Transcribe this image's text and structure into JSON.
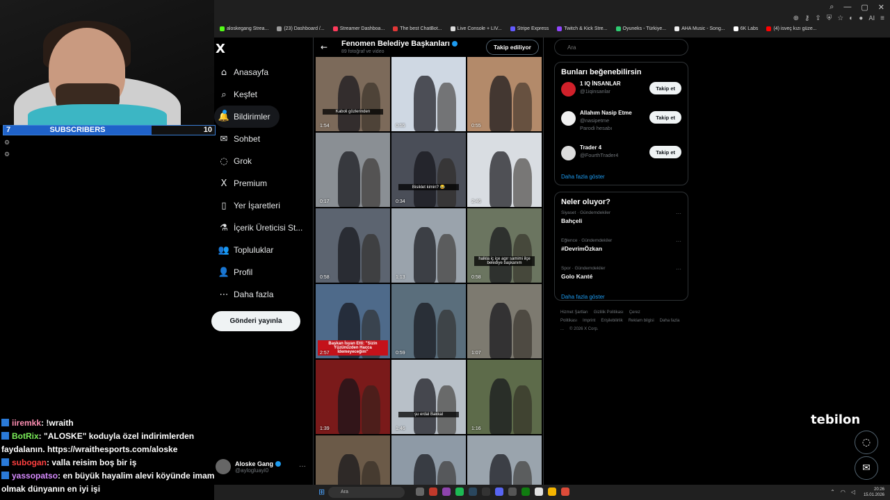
{
  "browser": {
    "bookmarks": [
      {
        "label": "aloskegang Strea...",
        "color": "#53fc18"
      },
      {
        "label": "(23) Dashboard /...",
        "color": "#9b9b9b"
      },
      {
        "label": "Streamer Dashboa...",
        "color": "#ff3b5c"
      },
      {
        "label": "The best ChatBot...",
        "color": "#e23737"
      },
      {
        "label": "Live Console + LIV...",
        "color": "#dddddd"
      },
      {
        "label": "Stripe Express",
        "color": "#635bff"
      },
      {
        "label": "Twitch & Kick Stre...",
        "color": "#9146ff"
      },
      {
        "label": "Oyuneks - Türkiye...",
        "color": "#2ecc71"
      },
      {
        "label": "AHA Music - Song...",
        "color": "#eeeeee"
      },
      {
        "label": "6K Labs",
        "color": "#ffffff"
      },
      {
        "label": "(4) isveç kızı güze...",
        "color": "#ff0000"
      }
    ],
    "ai_label": "AI"
  },
  "stream": {
    "sub_count": "7",
    "sub_label": "SUBSCRIBERS",
    "sub_goal": "10",
    "sub_progress": 0.7,
    "brand": "tebilon",
    "chat": [
      {
        "user": "iiremkk",
        "text": ": !wraith",
        "cls": "user1"
      },
      {
        "user": "BotRix",
        "text": ": \"ALOSKE\" koduyla özel indirimlerden faydalanın. https://wraithesports.com/aloske",
        "cls": "user2"
      },
      {
        "user": "subogan",
        "text": ": valla reisim boş bir iş",
        "cls": "user3"
      },
      {
        "user": "yassopatso",
        "text": ": en büyük hayalim alevi köyünde imam olmak dünyanın en iyi işi",
        "cls": "user4"
      }
    ]
  },
  "nav": {
    "logo": "X",
    "items": [
      {
        "label": "Anasayfa",
        "icon": "⌂",
        "name": "nav-home"
      },
      {
        "label": "Keşfet",
        "icon": "⌕",
        "name": "nav-explore"
      },
      {
        "label": "Bildirimler",
        "icon": "🔔",
        "name": "nav-notifications"
      },
      {
        "label": "Sohbet",
        "icon": "✉",
        "name": "nav-chat"
      },
      {
        "label": "Grok",
        "icon": "◌",
        "name": "nav-grok"
      },
      {
        "label": "Premium",
        "icon": "X",
        "name": "nav-premium"
      },
      {
        "label": "Yer İşaretleri",
        "icon": "▯",
        "name": "nav-bookmarks"
      },
      {
        "label": "İçerik Üreticisi St...",
        "icon": "⚗",
        "name": "nav-creator-studio"
      },
      {
        "label": "Topluluklar",
        "icon": "👥",
        "name": "nav-communities"
      },
      {
        "label": "Profil",
        "icon": "👤",
        "name": "nav-profile"
      },
      {
        "label": "Daha fazla",
        "icon": "⋯",
        "name": "nav-more"
      }
    ],
    "post_button": "Gönderi yayınla",
    "account": {
      "name": "Aloske Gang",
      "handle": "@aylogluayi0",
      "more": "···"
    }
  },
  "main": {
    "back": "←",
    "title": "Fenomen Belediye Başkanları",
    "subtitle": "89 fotoğraf ve video",
    "follow_button": "Takip ediliyor",
    "tiles": [
      {
        "dur": "1:54",
        "bg": "#7c6a5a",
        "cap": "Kaboli gözlerinden"
      },
      {
        "dur": "0:55",
        "bg": "#cfd8e3",
        "cap": ""
      },
      {
        "dur": "0:55",
        "bg": "#b38a6a",
        "cap": ""
      },
      {
        "dur": "0:17",
        "bg": "#8a8f94",
        "cap": ""
      },
      {
        "dur": "0:34",
        "bg": "#4a4e58",
        "cap": "Bisiklet kimin? 😂"
      },
      {
        "dur": "2:46",
        "bg": "#d9dde2",
        "cap": ""
      },
      {
        "dur": "0:58",
        "bg": "#5c6470",
        "cap": ""
      },
      {
        "dur": "1:13",
        "bg": "#9aa3ac",
        "cap": ""
      },
      {
        "dur": "0:58",
        "bg": "#6b7560",
        "cap": "halkla iç içe agır samimi ilçe belediye başkanım"
      },
      {
        "dur": "2:57",
        "bg": "#4e6a8a",
        "cap": "",
        "red": "Başkan İsyan Etti: \"Sizin Yüzünüzden Hacca İdemeyeceğim\""
      },
      {
        "dur": "0:59",
        "bg": "#5a6e7c",
        "cap": ""
      },
      {
        "dur": "1:07",
        "bg": "#7d7a70",
        "cap": ""
      },
      {
        "dur": "1:39",
        "bg": "#7a1a1a",
        "cap": ""
      },
      {
        "dur": "1:46",
        "bg": "#b8c0c8",
        "cap": "şu erdal Bakkal"
      },
      {
        "dur": "1:16",
        "bg": "#5d6b4a",
        "cap": ""
      },
      {
        "dur": "",
        "bg": "#6b5a48",
        "cap": ""
      },
      {
        "dur": "",
        "bg": "#8e9aa6",
        "cap": ""
      },
      {
        "dur": "",
        "bg": "#9aa4ad",
        "cap": ""
      }
    ]
  },
  "right": {
    "search_placeholder": "Ara",
    "who_title": "Bunları beğenebilirsin",
    "who": [
      {
        "name": "1 IQ İNSANLAR",
        "handle": "@1iqinsanlar",
        "parody": "",
        "button": "Takip et",
        "avatar": "#d0202a"
      },
      {
        "name": "Allahım Nasip Etme",
        "handle": "@nasipetme",
        "parody": "Parodi hesabı",
        "button": "Takip et",
        "avatar": "#f0f0f0"
      },
      {
        "name": "Trader 4",
        "handle": "@FourthTrader4",
        "parody": "",
        "button": "Takip et",
        "avatar": "#dcdcdc"
      }
    ],
    "who_more": "Daha fazla göster",
    "trends_title": "Neler oluyor?",
    "trends": [
      {
        "meta": "Siyaset · Gündemdekiler",
        "topic": "Bahçeli"
      },
      {
        "meta": "Eğlence · Gündemdekiler",
        "topic": "#DevrimÖzkan"
      },
      {
        "meta": "Spor · Gündemdekiler",
        "topic": "Golo Kanté"
      }
    ],
    "trends_more": "Daha fazla göster",
    "footer": [
      "Hizmet Şartları",
      "Gizlilik Politikası",
      "Çerez Politikası",
      "Imprint",
      "Erişilebilirlik",
      "Reklam bilgisi",
      "Daha fazla ...",
      "© 2026 X Corp."
    ]
  },
  "taskbar": {
    "search": "Ara",
    "time": "20:26",
    "date": "15.01.2026"
  }
}
